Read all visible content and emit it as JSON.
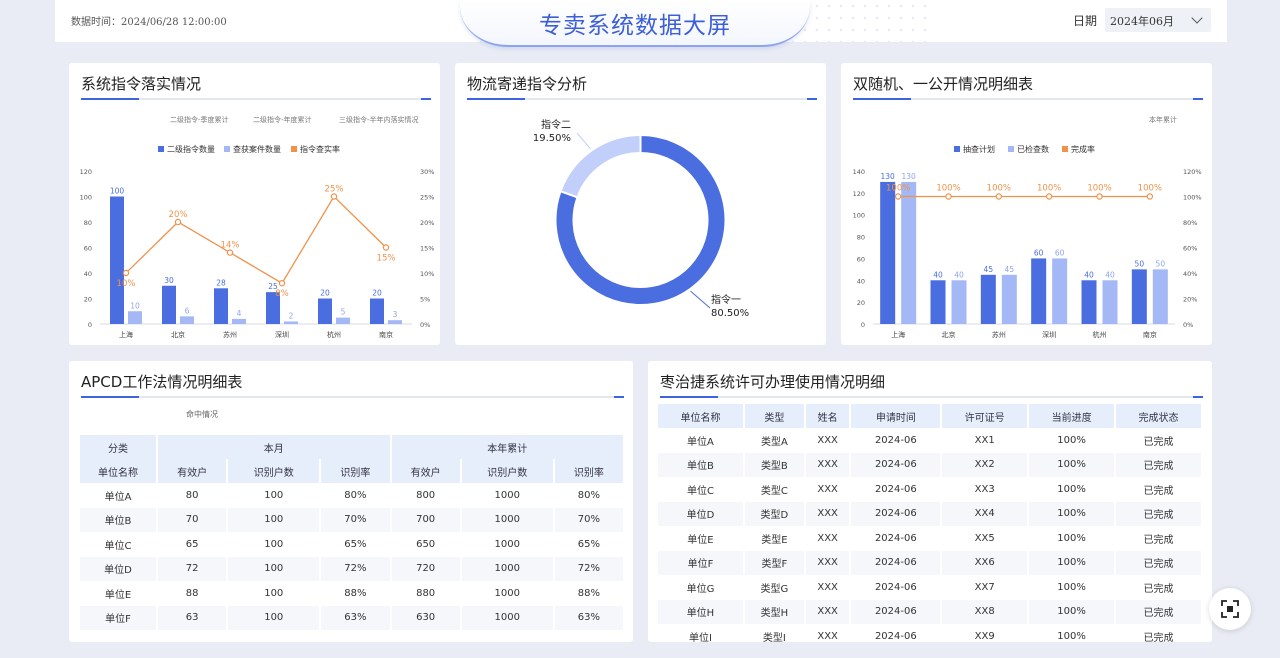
{
  "header": {
    "timestamp": "数据时间：2024/06/28  12:00:00",
    "title": "专卖系统数据大屏",
    "date_label": "日期",
    "date_value": "2024年06月"
  },
  "panel1": {
    "title": "系统指令落实情况",
    "tabs": [
      "二级指令-季度累计",
      "二级指令-年度累计",
      "三级指令-半年内落实情况"
    ],
    "legend": [
      "二级指令数量",
      "查获案件数量",
      "指令查实率"
    ]
  },
  "panel2": {
    "title": "物流寄递指令分析"
  },
  "panel3": {
    "title": "双随机、一公开情况明细表",
    "tab": "本年累计",
    "legend": [
      "抽查计划",
      "已检查数",
      "完成率"
    ]
  },
  "panel4": {
    "title": "APCD工作法情况明细表",
    "subtitle": "命中情况",
    "group_headers": [
      "分类",
      "本月",
      "本年累计"
    ],
    "headers": [
      "单位名称",
      "有效户",
      "识别户数",
      "识别率",
      "有效户",
      "识别户数",
      "识别率"
    ],
    "rows": [
      [
        "单位A",
        "80",
        "100",
        "80%",
        "800",
        "1000",
        "80%"
      ],
      [
        "单位B",
        "70",
        "100",
        "70%",
        "700",
        "1000",
        "70%"
      ],
      [
        "单位C",
        "65",
        "100",
        "65%",
        "650",
        "1000",
        "65%"
      ],
      [
        "单位D",
        "72",
        "100",
        "72%",
        "720",
        "1000",
        "72%"
      ],
      [
        "单位E",
        "88",
        "100",
        "88%",
        "880",
        "1000",
        "88%"
      ],
      [
        "单位F",
        "63",
        "100",
        "63%",
        "630",
        "1000",
        "63%"
      ]
    ]
  },
  "panel5": {
    "title": "枣治捷系统许可办理使用情况明细",
    "headers": [
      "单位名称",
      "类型",
      "姓名",
      "申请时间",
      "许可证号",
      "当前进度",
      "完成状态"
    ],
    "rows": [
      [
        "单位A",
        "类型A",
        "XXX",
        "2024-06",
        "XX1",
        "100%",
        "已完成"
      ],
      [
        "单位B",
        "类型B",
        "XXX",
        "2024-06",
        "XX2",
        "100%",
        "已完成"
      ],
      [
        "单位C",
        "类型C",
        "XXX",
        "2024-06",
        "XX3",
        "100%",
        "已完成"
      ],
      [
        "单位D",
        "类型D",
        "XXX",
        "2024-06",
        "XX4",
        "100%",
        "已完成"
      ],
      [
        "单位E",
        "类型E",
        "XXX",
        "2024-06",
        "XX5",
        "100%",
        "已完成"
      ],
      [
        "单位F",
        "类型F",
        "XXX",
        "2024-06",
        "XX6",
        "100%",
        "已完成"
      ],
      [
        "单位G",
        "类型G",
        "XXX",
        "2024-06",
        "XX7",
        "100%",
        "已完成"
      ],
      [
        "单位H",
        "类型H",
        "XXX",
        "2024-06",
        "XX8",
        "100%",
        "已完成"
      ],
      [
        "单位I",
        "类型I",
        "XXX",
        "2024-06",
        "XX9",
        "100%",
        "已完成"
      ]
    ]
  },
  "colors": {
    "bar_primary": "#4a6ee0",
    "bar_secondary": "#a4b8f5",
    "line": "#f0924a",
    "title": "#3c5fd8"
  },
  "icons": {
    "date_dropdown": "chevron-down-icon",
    "fab": "fullscreen-icon"
  },
  "chart_data": [
    {
      "type": "bar",
      "categories": [
        "上海",
        "北京",
        "苏州",
        "深圳",
        "杭州",
        "南京"
      ],
      "series": [
        {
          "name": "二级指令数量",
          "type": "bar",
          "values": [
            100,
            30,
            28,
            25,
            20,
            20
          ]
        },
        {
          "name": "查获案件数量",
          "type": "bar",
          "values": [
            10,
            6,
            4,
            2,
            5,
            3
          ]
        },
        {
          "name": "指令查实率",
          "type": "line",
          "axis": "right",
          "values": [
            10,
            20,
            14,
            8,
            25,
            15
          ],
          "labels": [
            "10%",
            "20%",
            "14%",
            "8%",
            "25%",
            "15%"
          ]
        }
      ],
      "ylim": [
        0,
        120
      ],
      "yticks": [
        0,
        20,
        40,
        60,
        80,
        100,
        120
      ],
      "y2lim": [
        0,
        30
      ],
      "y2ticks": [
        "0%",
        "5%",
        "10%",
        "15%",
        "20%",
        "25%",
        "30%"
      ],
      "legend_position": "top"
    },
    {
      "type": "pie",
      "donut": true,
      "slices": [
        {
          "name": "指令一",
          "value": 80.5,
          "label": "80.50%"
        },
        {
          "name": "指令二",
          "value": 19.5,
          "label": "19.50%"
        }
      ]
    },
    {
      "type": "bar",
      "categories": [
        "上海",
        "北京",
        "苏州",
        "深圳",
        "杭州",
        "南京"
      ],
      "series": [
        {
          "name": "抽查计划",
          "type": "bar",
          "values": [
            130,
            40,
            45,
            60,
            40,
            50
          ]
        },
        {
          "name": "已检查数",
          "type": "bar",
          "values": [
            130,
            40,
            45,
            60,
            40,
            50
          ]
        },
        {
          "name": "完成率",
          "type": "line",
          "axis": "right",
          "values": [
            100,
            100,
            100,
            100,
            100,
            100
          ],
          "labels": [
            "100%",
            "100%",
            "100%",
            "100%",
            "100%",
            "100%"
          ]
        }
      ],
      "ylim": [
        0,
        140
      ],
      "yticks": [
        0,
        20,
        40,
        60,
        80,
        100,
        120,
        140
      ],
      "y2lim": [
        0,
        120
      ],
      "y2ticks": [
        "0%",
        "20%",
        "40%",
        "60%",
        "80%",
        "100%",
        "120%"
      ],
      "legend_position": "top"
    }
  ]
}
